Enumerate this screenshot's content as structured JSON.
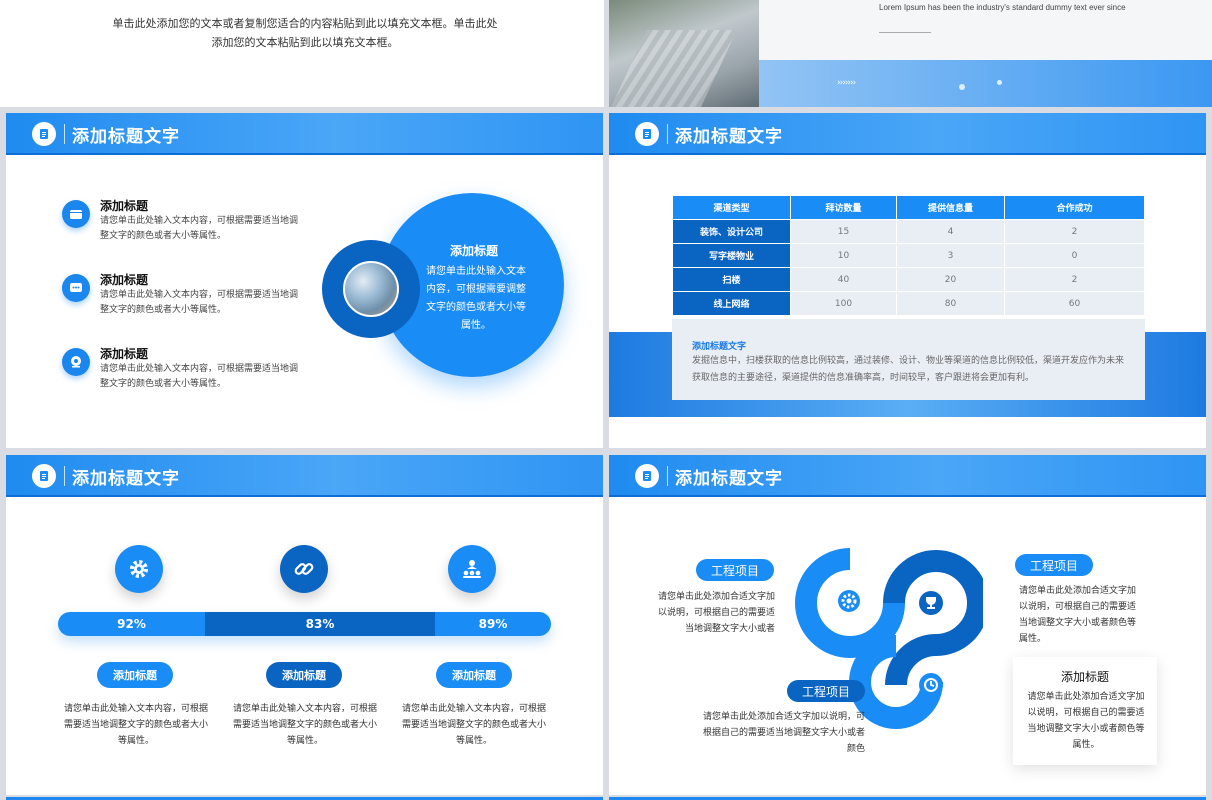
{
  "top_left": {
    "text": "单击此处添加您的文本或者复制您适合的内容粘贴到此以填充文本框。单击此处添加您的文本粘贴到此以填充文本框。"
  },
  "top_right": {
    "lorem": "Lorem Ipsum has been the industry's standard dummy text ever since",
    "arrows": "›››››››"
  },
  "header_title": "添加标题文字",
  "slide1": {
    "items": [
      {
        "title": "添加标题",
        "desc": "请您单击此处输入文本内容，可根据需要适当地调整文字的颜色或者大小等属性。"
      },
      {
        "title": "添加标题",
        "desc": "请您单击此处输入文本内容，可根据需要适当地调整文字的颜色或者大小等属性。"
      },
      {
        "title": "添加标题",
        "desc": "请您单击此处输入文本内容，可根据需要适当地调整文字的颜色或者大小等属性。"
      }
    ],
    "circle_title": "添加标题",
    "circle_text": "请您单击此处输入文本内容，可根据需要调整文字的颜色或者大小等属性。"
  },
  "slide2": {
    "table": {
      "headers": [
        "渠道类型",
        "拜访数量",
        "提供信息量",
        "合作成功"
      ],
      "rows": [
        [
          "装饰、设计公司",
          "15",
          "4",
          "2"
        ],
        [
          "写字楼物业",
          "10",
          "3",
          "0"
        ],
        [
          "扫楼",
          "40",
          "20",
          "2"
        ],
        [
          "线上网络",
          "100",
          "80",
          "60"
        ]
      ]
    },
    "note_title": "添加标题文字",
    "note_text": "发掘信息中，扫楼获取的信息比例较高，通过装修、设计、物业等渠道的信息比例较低，渠道开发应作为未来获取信息的主要途径，渠道提供的信息准确率高，时间较早，客户跟进将会更加有利。"
  },
  "slide3": {
    "icons": [
      "gear-icon",
      "link-icon",
      "team-icon"
    ],
    "progress": [
      {
        "label": "92%",
        "value": 92,
        "color": "#1a8cf5"
      },
      {
        "label": "83%",
        "value": 83,
        "color": "#0a64c2"
      },
      {
        "label": "89%",
        "value": 89,
        "color": "#1a8cf5"
      }
    ],
    "pills": [
      "添加标题",
      "添加标题",
      "添加标题"
    ],
    "descs": [
      "请您单击此处输入文本内容，可根据需要适当地调整文字的颜色或者大小等属性。",
      "请您单击此处输入文本内容，可根据需要适当地调整文字的颜色或者大小等属性。",
      "请您单击此处输入文本内容，可根据需要适当地调整文字的颜色或者大小等属性。"
    ]
  },
  "slide4": {
    "pill_left": "工程项目",
    "desc_left": "请您单击此处添加合适文字加以说明，可根据自己的需要适当地调整文字大小或者",
    "pill_right": "工程项目",
    "desc_right": "请您单击此处添加合适文字加以说明，可根据自己的需要适当地调整文字大小或者颜色等属性。",
    "pill_bottom": "工程项目",
    "desc_bottom": "请您单击此处添加合适文字加以说明，可根据自己的需要适当地调整文字大小或者颜色",
    "card_title": "添加标题",
    "card_text": "请您单击此处添加合适文字加以说明，可根据自己的需要适当地调整文字大小或者颜色等属性。"
  },
  "colors": {
    "primary": "#1a8cf5",
    "dark": "#0a64c2",
    "light_bg": "#e9eef5"
  }
}
